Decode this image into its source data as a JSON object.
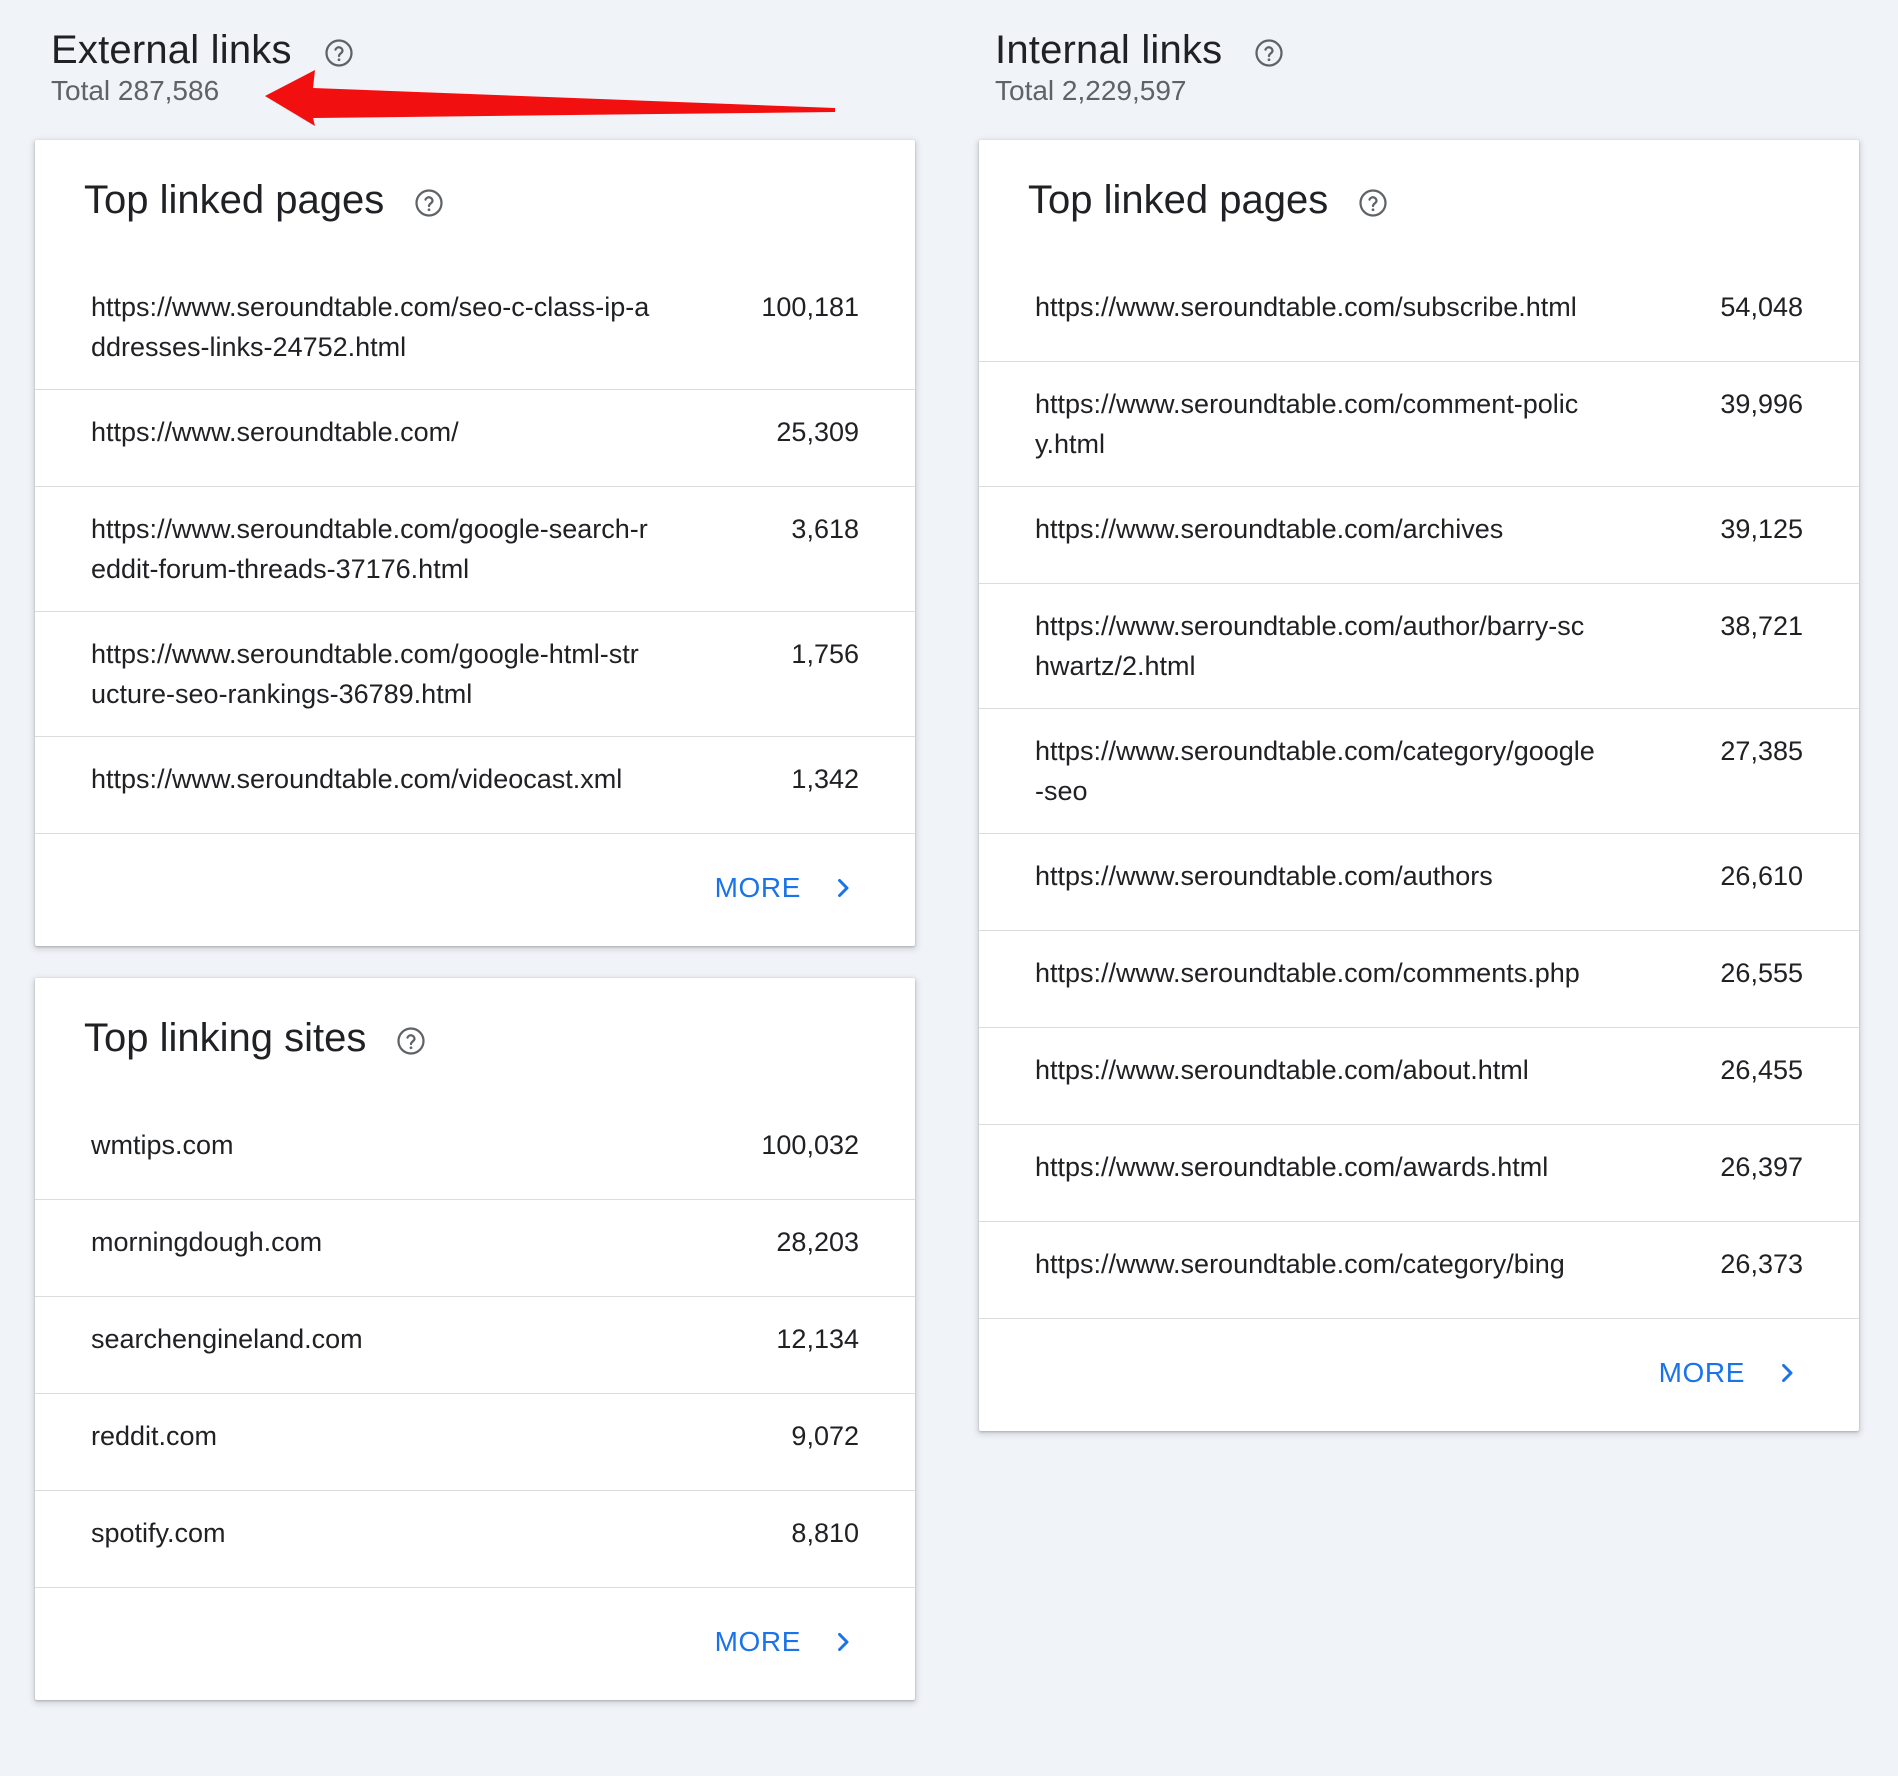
{
  "external": {
    "title": "External links",
    "total": "Total 287,586",
    "top_linked_pages": {
      "title": "Top linked pages",
      "rows": [
        {
          "url": "https://www.seroundtable.com/seo-c-class-ip-addresses-links-24752.html",
          "count": "100,181"
        },
        {
          "url": "https://www.seroundtable.com/",
          "count": "25,309"
        },
        {
          "url": "https://www.seroundtable.com/google-search-reddit-forum-threads-37176.html",
          "count": "3,618"
        },
        {
          "url": "https://www.seroundtable.com/google-html-structure-seo-rankings-36789.html",
          "count": "1,756"
        },
        {
          "url": "https://www.seroundtable.com/videocast.xml",
          "count": "1,342"
        }
      ],
      "more_label": "MORE"
    },
    "top_linking_sites": {
      "title": "Top linking sites",
      "rows": [
        {
          "url": "wmtips.com",
          "count": "100,032"
        },
        {
          "url": "morningdough.com",
          "count": "28,203"
        },
        {
          "url": "searchengineland.com",
          "count": "12,134"
        },
        {
          "url": "reddit.com",
          "count": "9,072"
        },
        {
          "url": "spotify.com",
          "count": "8,810"
        }
      ],
      "more_label": "MORE"
    }
  },
  "internal": {
    "title": "Internal links",
    "total": "Total 2,229,597",
    "top_linked_pages": {
      "title": "Top linked pages",
      "rows": [
        {
          "url": "https://www.seroundtable.com/subscribe.html",
          "count": "54,048"
        },
        {
          "url": "https://www.seroundtable.com/comment-policy.html",
          "count": "39,996"
        },
        {
          "url": "https://www.seroundtable.com/archives",
          "count": "39,125"
        },
        {
          "url": "https://www.seroundtable.com/author/barry-schwartz/2.html",
          "count": "38,721"
        },
        {
          "url": "https://www.seroundtable.com/category/google-seo",
          "count": "27,385"
        },
        {
          "url": "https://www.seroundtable.com/authors",
          "count": "26,610"
        },
        {
          "url": "https://www.seroundtable.com/comments.php",
          "count": "26,555"
        },
        {
          "url": "https://www.seroundtable.com/about.html",
          "count": "26,455"
        },
        {
          "url": "https://www.seroundtable.com/awards.html",
          "count": "26,397"
        },
        {
          "url": "https://www.seroundtable.com/category/bing",
          "count": "26,373"
        }
      ],
      "more_label": "MORE"
    }
  },
  "icons": {
    "help": "help-circle-icon",
    "chevron": "chevron-right-icon",
    "annotation": "red-arrow-annotation"
  },
  "colors": {
    "background": "#f0f3f8",
    "accent": "#1a73e8",
    "annotation": "#ff0000"
  }
}
